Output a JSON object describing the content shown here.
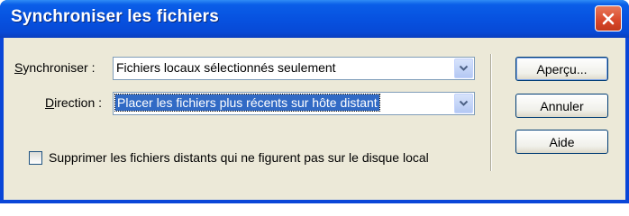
{
  "window": {
    "title": "Synchroniser les fichiers",
    "close_icon": "close-icon"
  },
  "form": {
    "sync_label_accesskey": "S",
    "sync_label_rest": "ynchroniser :",
    "sync_value": "Fichiers locaux sélectionnés seulement",
    "direction_label_accesskey": "D",
    "direction_label_rest": "irection :",
    "direction_value": "Placer les fichiers plus récents sur hôte distant",
    "delete_checkbox_label": "Supprimer les fichiers distants qui ne figurent pas sur le disque local",
    "delete_checkbox_checked": false
  },
  "buttons": {
    "preview": "Aperçu...",
    "cancel": "Annuler",
    "help": "Aide"
  },
  "colors": {
    "titlebar": "#0752e0",
    "close": "#d8472a",
    "dialog_bg": "#ece9d8",
    "selection": "#316ac5"
  }
}
